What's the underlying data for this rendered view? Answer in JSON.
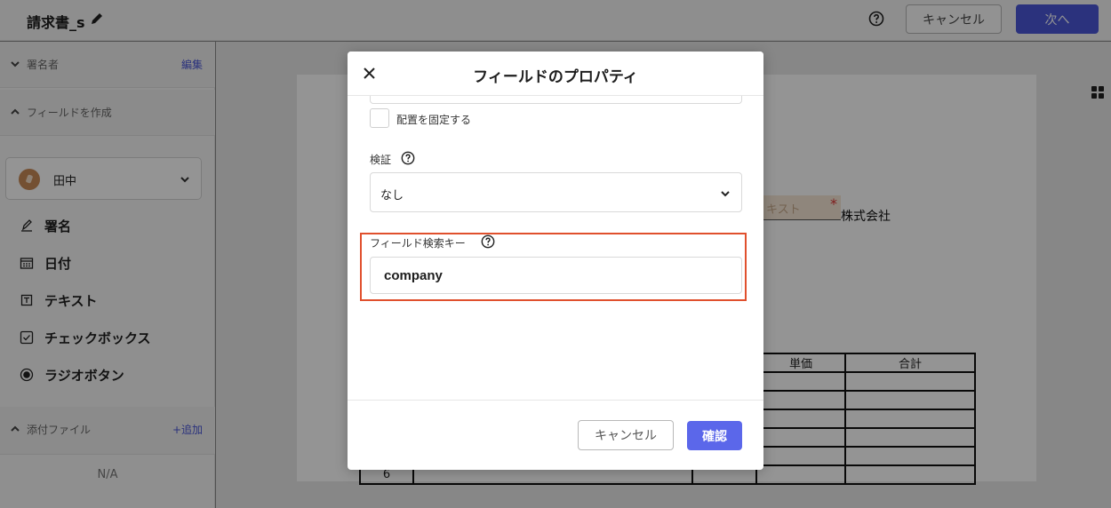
{
  "topbar": {
    "title": "請求書_s",
    "cancel_label": "キャンセル",
    "next_label": "次へ"
  },
  "sidebar": {
    "signers_section": {
      "label": "署名者",
      "action": "編集"
    },
    "create_fields_section": {
      "label": "フィールドを作成"
    },
    "signer_select": {
      "value": "田中"
    },
    "tools": [
      {
        "label": "署名",
        "icon": "signature-pen-icon"
      },
      {
        "label": "日付",
        "icon": "calendar-icon"
      },
      {
        "label": "テキスト",
        "icon": "text-box-icon"
      },
      {
        "label": "チェックボックス",
        "icon": "checkbox-icon"
      },
      {
        "label": "ラジオボタン",
        "icon": "radio-button-icon"
      }
    ],
    "attachments_section": {
      "label": "添付ファイル",
      "action": "+追加"
    },
    "attachments_empty": "N/A"
  },
  "document": {
    "company_suffix": "株式会社",
    "required_mark": "*",
    "field_placeholder": "キスト",
    "table_headers": [
      "単価",
      "合計"
    ],
    "row_number": "6"
  },
  "modal": {
    "title": "フィールドのプロパティ",
    "fix_position_label": "配置を固定する",
    "fix_position_checked": false,
    "validation_label": "検証",
    "validation_value": "なし",
    "search_key_label": "フィールド検索キー",
    "search_key_value": "company",
    "cancel_label": "キャンセル",
    "confirm_label": "確認"
  },
  "colors": {
    "primary": "#4a56d8",
    "confirm": "#5b67ea",
    "highlight": "#e0502d"
  }
}
